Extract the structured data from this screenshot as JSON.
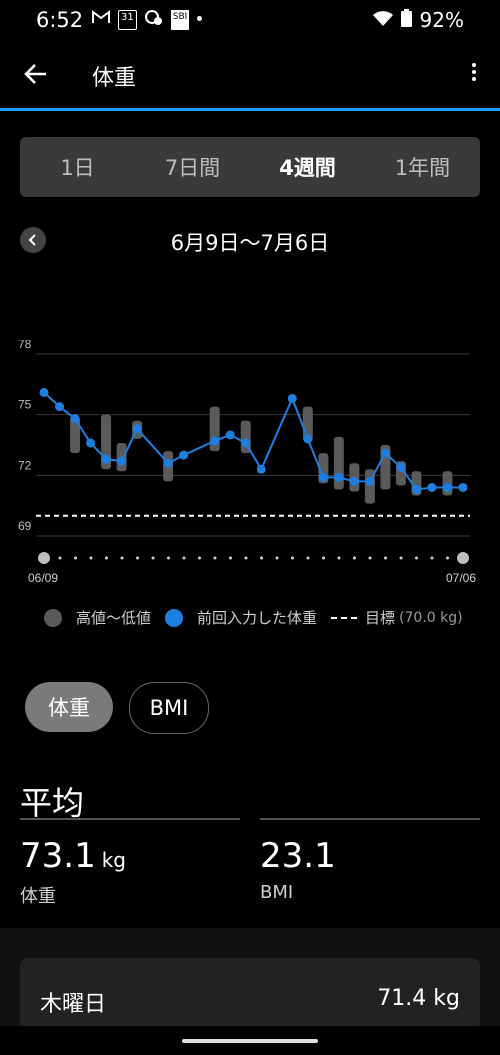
{
  "status": {
    "time": "6:52",
    "battery": "92%",
    "icons": [
      "gmail-icon",
      "calendar-icon",
      "messages-icon",
      "sbi-icon",
      "dot-icon"
    ],
    "icon_labels": {
      "calendar": "31",
      "sbi": "SBI"
    }
  },
  "app": {
    "title": "体重"
  },
  "tabs": [
    "1日",
    "7日間",
    "4週間",
    "1年間"
  ],
  "active_tab": "4週間",
  "range_label": "6月9日〜7月6日",
  "chart_data": {
    "type": "line",
    "y_ticks": [
      "78",
      "75",
      "72",
      "69"
    ],
    "ylim": [
      69,
      78
    ],
    "x_start_label": "06/09",
    "x_end_label": "07/06",
    "goal_value": 70.0,
    "x": [
      "06/09",
      "06/10",
      "06/11",
      "06/12",
      "06/13",
      "06/14",
      "06/15",
      "06/16",
      "06/17",
      "06/18",
      "06/19",
      "06/20",
      "06/21",
      "06/22",
      "06/23",
      "06/24",
      "06/25",
      "06/26",
      "06/27",
      "06/28",
      "06/29",
      "06/30",
      "07/01",
      "07/02",
      "07/03",
      "07/04",
      "07/05",
      "07/06"
    ],
    "series": [
      {
        "values": [
          76.1,
          75.4,
          74.8,
          73.6,
          72.8,
          72.7,
          74.3,
          null,
          72.6,
          73.0,
          null,
          73.7,
          74.0,
          73.6,
          72.3,
          null,
          75.8,
          73.8,
          71.9,
          71.9,
          71.7,
          71.7,
          73.1,
          72.4,
          71.3,
          71.4,
          71.4,
          71.4
        ]
      }
    ],
    "ranges": [
      [
        null,
        null
      ],
      [
        null,
        null
      ],
      [
        73.1,
        74.9
      ],
      [
        null,
        null
      ],
      [
        72.3,
        75.0
      ],
      [
        72.2,
        73.6
      ],
      [
        73.8,
        74.7
      ],
      [
        null,
        null
      ],
      [
        71.7,
        73.2
      ],
      [
        null,
        null
      ],
      [
        null,
        null
      ],
      [
        73.2,
        75.4
      ],
      [
        null,
        null
      ],
      [
        73.1,
        74.7
      ],
      [
        null,
        null
      ],
      [
        null,
        null
      ],
      [
        null,
        null
      ],
      [
        73.7,
        75.4
      ],
      [
        71.6,
        73.1
      ],
      [
        71.3,
        73.9
      ],
      [
        71.2,
        72.6
      ],
      [
        70.6,
        72.3
      ],
      [
        71.3,
        73.5
      ],
      [
        71.5,
        72.7
      ],
      [
        71.0,
        72.2
      ],
      [
        null,
        null
      ],
      [
        71.0,
        72.2
      ],
      [
        null,
        null
      ]
    ],
    "colors": {
      "line": "#1e7fe0",
      "range": "#5a5a5a",
      "grid": "#3a3a3a",
      "goal": "#ffffff"
    }
  },
  "legend": {
    "range": "高値〜低値",
    "latest": "前回入力した体重",
    "goal": "目標",
    "goal_value": "(70.0 kg)"
  },
  "toggles": [
    "体重",
    "BMI"
  ],
  "average": {
    "title": "平均",
    "weight_value": "73.1",
    "weight_unit": "kg",
    "weight_label": "体重",
    "bmi_value": "23.1",
    "bmi_label": "BMI"
  },
  "card": {
    "day": "木曜日",
    "value": "71.4 kg"
  }
}
